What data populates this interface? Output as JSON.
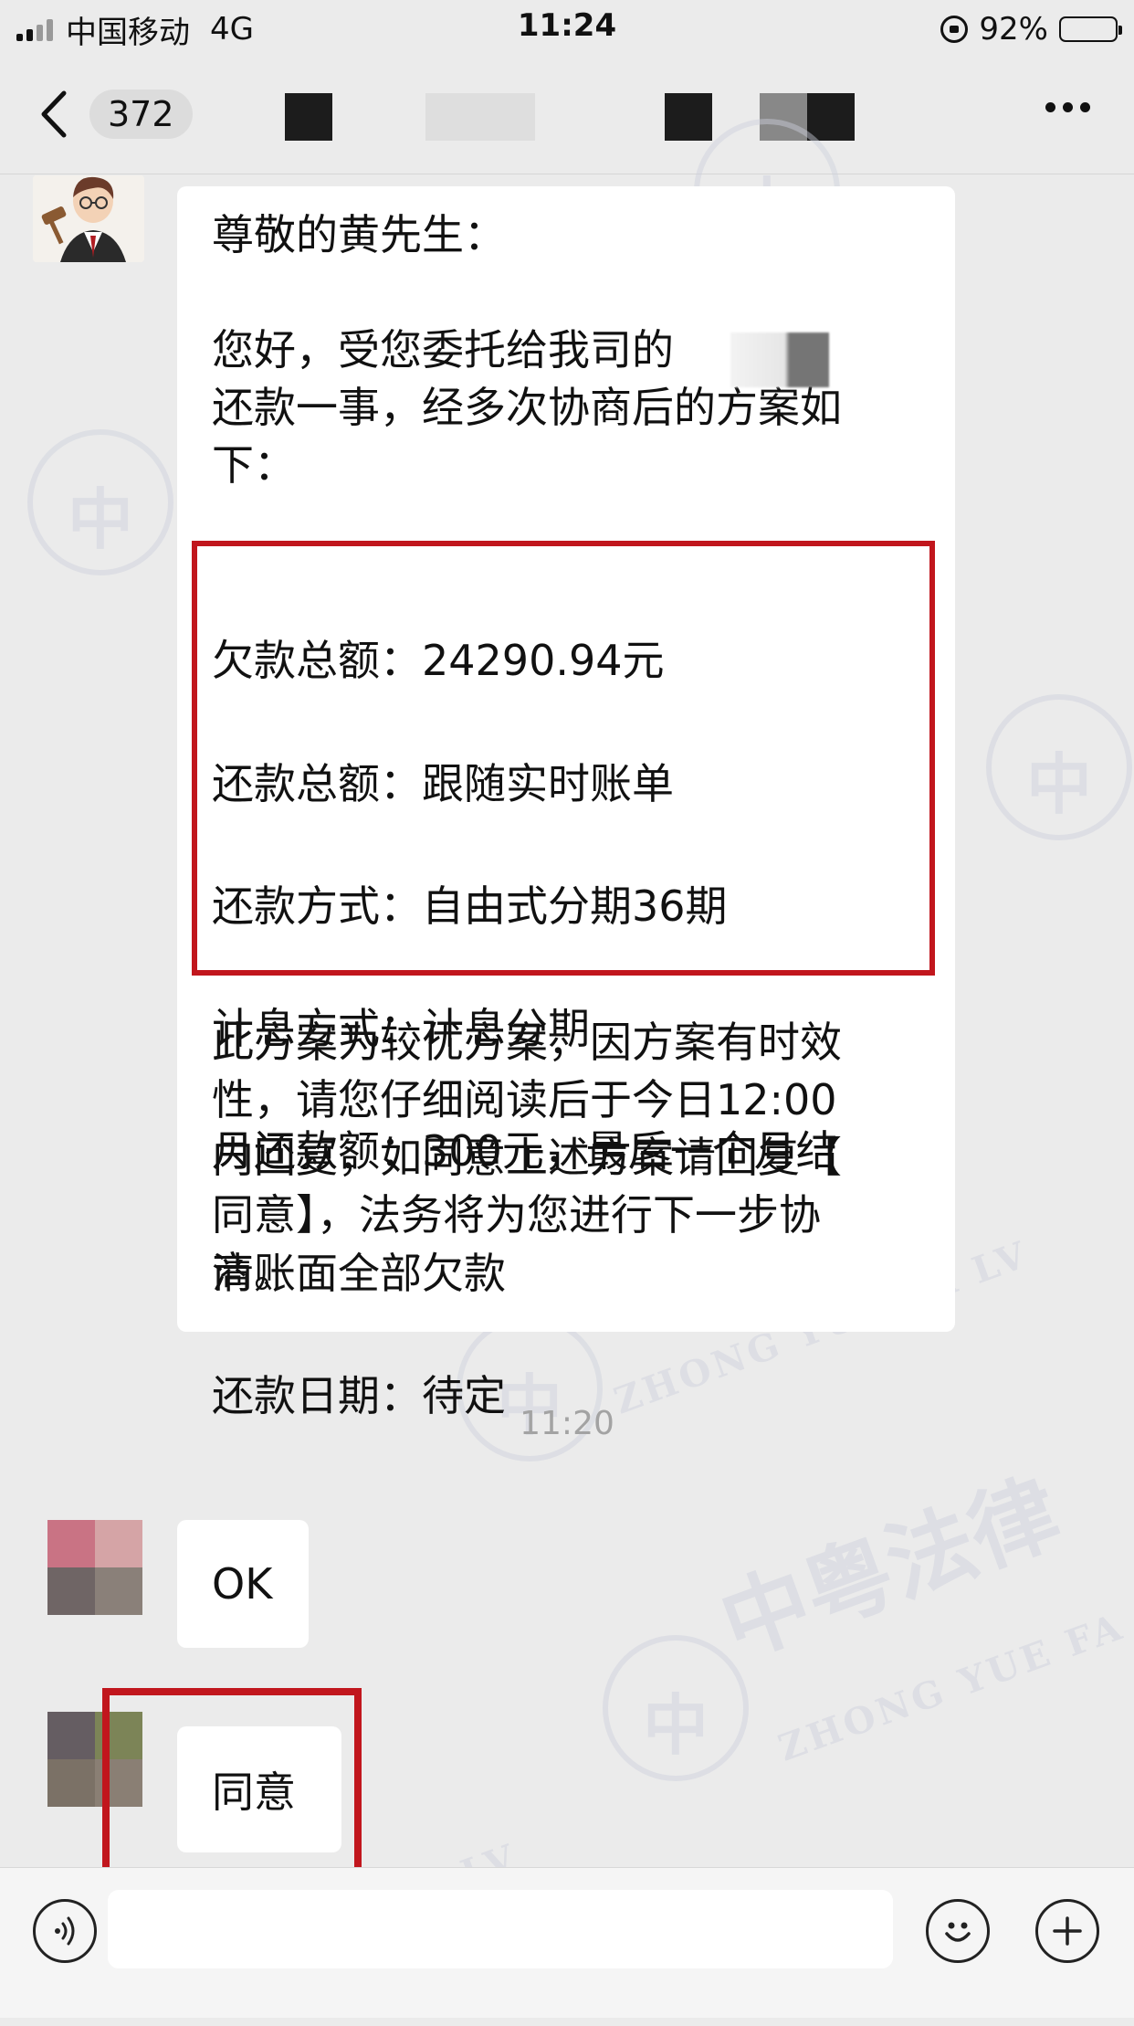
{
  "status_bar": {
    "carrier": "中国移动",
    "network": "4G",
    "time": "11:24",
    "battery_pct": "92%",
    "battery_level": 0.92
  },
  "nav": {
    "back_count": "372"
  },
  "conversation": {
    "lawyer_message": {
      "greeting": "尊敬的黄先生：",
      "intro": "您好，受您委托给我司的\n还款一事，经多次协商后的方案如\n下：",
      "plan_lines": [
        "欠款总额：24290.94元",
        "还款总额：跟随实时账单",
        "还款方式：自由式分期36期",
        "计息方式：计息分期",
        "月还款额：300元，最后一个月结",
        "清账面全部欠款",
        "还款日期：待定"
      ],
      "closing": "此方案为较优方案，因方案有时效\n性，请您仔细阅读后于今日12:00\n内回复，如同意上述方案请回复【\n同意】，法务将为您进行下一步协\n商。"
    },
    "timestamp": "11:20",
    "user_replies": [
      "OK",
      "同意"
    ]
  },
  "watermark": {
    "cn": "中粤法律",
    "en": "ZHONG YUE FA LV"
  },
  "colors": {
    "background": "#ebebeb",
    "bubble": "#ffffff",
    "highlight": "#c1161d"
  }
}
